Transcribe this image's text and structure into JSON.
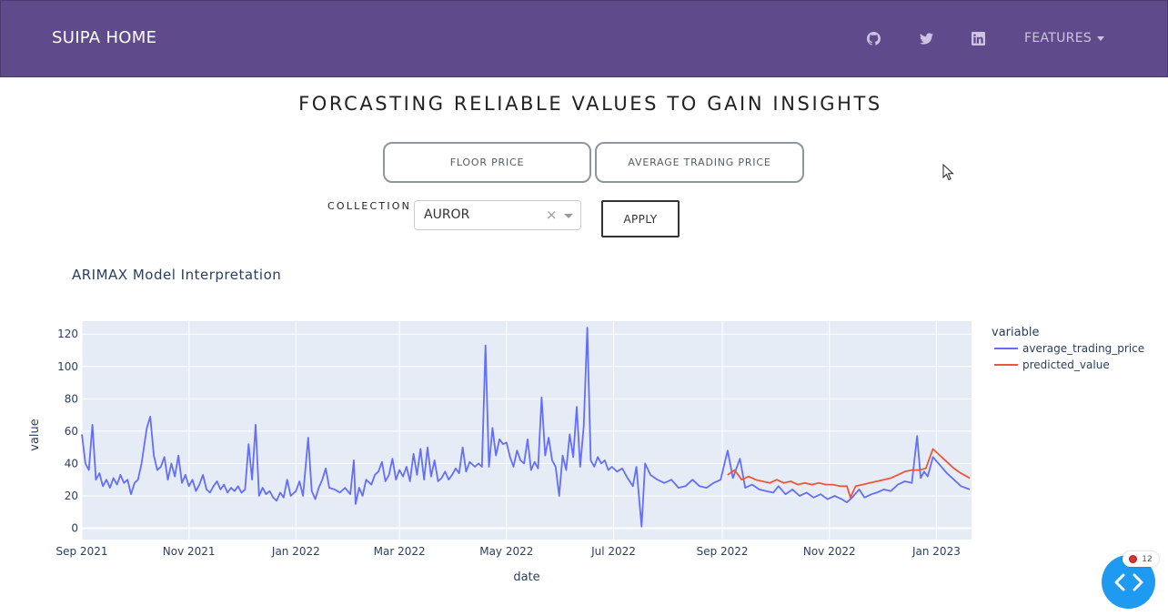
{
  "navbar": {
    "brand": "SUIPA HOME",
    "icons": [
      "github-icon",
      "twitter-icon",
      "linkedin-icon"
    ],
    "features_label": "FEATURES",
    "bg_color": "#5f4b8b"
  },
  "page": {
    "title": "FORCASTING RELIABLE VALUES TO GAIN INSIGHTS"
  },
  "tabs": [
    {
      "label": "FLOOR PRICE"
    },
    {
      "label": "AVERAGE TRADING PRICE"
    }
  ],
  "form": {
    "collection_label": "COLLECTION",
    "selected_collection": "AUROR",
    "clear_symbol": "×",
    "apply_label": "APPLY"
  },
  "debug_button": {
    "badge_count": "12",
    "color": "#1e9bf0"
  },
  "chart_data": {
    "type": "line",
    "title": "ARIMAX Model Interpretation",
    "xlabel": "date",
    "ylabel": "value",
    "legend_title": "variable",
    "legend_position": "right",
    "grid": true,
    "xlim": [
      "2021-09-01",
      "2023-01-21"
    ],
    "ylim": [
      -7,
      128
    ],
    "x_ticks": [
      {
        "date": "2021-09-01",
        "label": "Sep 2021"
      },
      {
        "date": "2021-11-01",
        "label": "Nov 2021"
      },
      {
        "date": "2022-01-01",
        "label": "Jan 2022"
      },
      {
        "date": "2022-03-01",
        "label": "Mar 2022"
      },
      {
        "date": "2022-05-01",
        "label": "May 2022"
      },
      {
        "date": "2022-07-01",
        "label": "Jul 2022"
      },
      {
        "date": "2022-09-01",
        "label": "Sep 2022"
      },
      {
        "date": "2022-11-01",
        "label": "Nov 2022"
      },
      {
        "date": "2023-01-01",
        "label": "Jan 2023"
      }
    ],
    "y_ticks": [
      0,
      20,
      40,
      60,
      80,
      100,
      120
    ],
    "series": [
      {
        "name": "average_trading_price",
        "color": "#636efa",
        "points": [
          [
            "2021-09-01",
            58
          ],
          [
            "2021-09-03",
            40
          ],
          [
            "2021-09-05",
            36
          ],
          [
            "2021-09-07",
            64
          ],
          [
            "2021-09-09",
            30
          ],
          [
            "2021-09-11",
            34
          ],
          [
            "2021-09-13",
            26
          ],
          [
            "2021-09-15",
            30
          ],
          [
            "2021-09-17",
            25
          ],
          [
            "2021-09-19",
            31
          ],
          [
            "2021-09-21",
            27
          ],
          [
            "2021-09-23",
            33
          ],
          [
            "2021-09-25",
            28
          ],
          [
            "2021-09-27",
            30
          ],
          [
            "2021-09-29",
            21
          ],
          [
            "2021-10-01",
            28
          ],
          [
            "2021-10-03",
            30
          ],
          [
            "2021-10-05",
            40
          ],
          [
            "2021-10-08",
            62
          ],
          [
            "2021-10-10",
            69
          ],
          [
            "2021-10-12",
            45
          ],
          [
            "2021-10-14",
            36
          ],
          [
            "2021-10-16",
            38
          ],
          [
            "2021-10-18",
            44
          ],
          [
            "2021-10-20",
            30
          ],
          [
            "2021-10-22",
            40
          ],
          [
            "2021-10-24",
            32
          ],
          [
            "2021-10-26",
            45
          ],
          [
            "2021-10-28",
            28
          ],
          [
            "2021-10-30",
            33
          ],
          [
            "2021-11-01",
            26
          ],
          [
            "2021-11-03",
            30
          ],
          [
            "2021-11-05",
            23
          ],
          [
            "2021-11-07",
            27
          ],
          [
            "2021-11-09",
            33
          ],
          [
            "2021-11-11",
            24
          ],
          [
            "2021-11-13",
            22
          ],
          [
            "2021-11-15",
            26
          ],
          [
            "2021-11-17",
            29
          ],
          [
            "2021-11-19",
            24
          ],
          [
            "2021-11-21",
            27
          ],
          [
            "2021-11-23",
            22
          ],
          [
            "2021-11-25",
            25
          ],
          [
            "2021-11-27",
            23
          ],
          [
            "2021-11-29",
            26
          ],
          [
            "2021-12-01",
            22
          ],
          [
            "2021-12-03",
            24
          ],
          [
            "2021-12-05",
            52
          ],
          [
            "2021-12-07",
            30
          ],
          [
            "2021-12-09",
            64
          ],
          [
            "2021-12-11",
            20
          ],
          [
            "2021-12-13",
            25
          ],
          [
            "2021-12-15",
            21
          ],
          [
            "2021-12-17",
            23
          ],
          [
            "2021-12-19",
            19
          ],
          [
            "2021-12-21",
            17
          ],
          [
            "2021-12-23",
            22
          ],
          [
            "2021-12-25",
            19
          ],
          [
            "2021-12-27",
            30
          ],
          [
            "2021-12-29",
            20
          ],
          [
            "2022-01-01",
            23
          ],
          [
            "2022-01-03",
            29
          ],
          [
            "2022-01-05",
            20
          ],
          [
            "2022-01-08",
            56
          ],
          [
            "2022-01-10",
            23
          ],
          [
            "2022-01-12",
            18
          ],
          [
            "2022-01-14",
            25
          ],
          [
            "2022-01-16",
            30
          ],
          [
            "2022-01-18",
            37
          ],
          [
            "2022-01-20",
            25
          ],
          [
            "2022-01-23",
            24
          ],
          [
            "2022-01-26",
            22
          ],
          [
            "2022-01-29",
            25
          ],
          [
            "2022-02-01",
            21
          ],
          [
            "2022-02-03",
            42
          ],
          [
            "2022-02-04",
            15
          ],
          [
            "2022-02-06",
            25
          ],
          [
            "2022-02-08",
            20
          ],
          [
            "2022-02-10",
            30
          ],
          [
            "2022-02-13",
            27
          ],
          [
            "2022-02-15",
            33
          ],
          [
            "2022-02-17",
            35
          ],
          [
            "2022-02-19",
            41
          ],
          [
            "2022-02-21",
            29
          ],
          [
            "2022-02-23",
            33
          ],
          [
            "2022-02-25",
            43
          ],
          [
            "2022-02-27",
            30
          ],
          [
            "2022-03-01",
            36
          ],
          [
            "2022-03-03",
            32
          ],
          [
            "2022-03-05",
            38
          ],
          [
            "2022-03-07",
            29
          ],
          [
            "2022-03-09",
            46
          ],
          [
            "2022-03-11",
            33
          ],
          [
            "2022-03-13",
            49
          ],
          [
            "2022-03-15",
            30
          ],
          [
            "2022-03-17",
            50
          ],
          [
            "2022-03-19",
            32
          ],
          [
            "2022-03-21",
            42
          ],
          [
            "2022-03-23",
            29
          ],
          [
            "2022-03-25",
            31
          ],
          [
            "2022-03-27",
            35
          ],
          [
            "2022-03-29",
            30
          ],
          [
            "2022-03-31",
            33
          ],
          [
            "2022-04-02",
            37
          ],
          [
            "2022-04-04",
            34
          ],
          [
            "2022-04-06",
            50
          ],
          [
            "2022-04-08",
            35
          ],
          [
            "2022-04-10",
            41
          ],
          [
            "2022-04-13",
            38
          ],
          [
            "2022-04-15",
            40
          ],
          [
            "2022-04-17",
            38
          ],
          [
            "2022-04-19",
            113
          ],
          [
            "2022-04-21",
            38
          ],
          [
            "2022-04-23",
            62
          ],
          [
            "2022-04-25",
            45
          ],
          [
            "2022-04-27",
            55
          ],
          [
            "2022-04-29",
            52
          ],
          [
            "2022-05-01",
            53
          ],
          [
            "2022-05-03",
            44
          ],
          [
            "2022-05-05",
            38
          ],
          [
            "2022-05-07",
            48
          ],
          [
            "2022-05-09",
            42
          ],
          [
            "2022-05-11",
            40
          ],
          [
            "2022-05-13",
            55
          ],
          [
            "2022-05-15",
            36
          ],
          [
            "2022-05-17",
            41
          ],
          [
            "2022-05-19",
            37
          ],
          [
            "2022-05-21",
            81
          ],
          [
            "2022-05-23",
            45
          ],
          [
            "2022-05-25",
            56
          ],
          [
            "2022-05-27",
            42
          ],
          [
            "2022-05-29",
            38
          ],
          [
            "2022-05-31",
            20
          ],
          [
            "2022-06-02",
            45
          ],
          [
            "2022-06-04",
            36
          ],
          [
            "2022-06-06",
            58
          ],
          [
            "2022-06-08",
            44
          ],
          [
            "2022-06-10",
            75
          ],
          [
            "2022-06-12",
            38
          ],
          [
            "2022-06-14",
            63
          ],
          [
            "2022-06-16",
            124
          ],
          [
            "2022-06-18",
            42
          ],
          [
            "2022-06-20",
            38
          ],
          [
            "2022-06-22",
            44
          ],
          [
            "2022-06-24",
            40
          ],
          [
            "2022-06-26",
            42
          ],
          [
            "2022-06-28",
            36
          ],
          [
            "2022-06-30",
            38
          ],
          [
            "2022-07-03",
            35
          ],
          [
            "2022-07-06",
            37
          ],
          [
            "2022-07-09",
            31
          ],
          [
            "2022-07-12",
            26
          ],
          [
            "2022-07-14",
            38
          ],
          [
            "2022-07-17",
            1
          ],
          [
            "2022-07-19",
            40
          ],
          [
            "2022-07-22",
            33
          ],
          [
            "2022-07-26",
            30
          ],
          [
            "2022-07-30",
            28
          ],
          [
            "2022-08-03",
            30
          ],
          [
            "2022-08-07",
            25
          ],
          [
            "2022-08-11",
            26
          ],
          [
            "2022-08-15",
            30
          ],
          [
            "2022-08-19",
            26
          ],
          [
            "2022-08-23",
            25
          ],
          [
            "2022-08-27",
            28
          ],
          [
            "2022-08-31",
            30
          ],
          [
            "2022-09-04",
            48
          ],
          [
            "2022-09-07",
            31
          ],
          [
            "2022-09-11",
            43
          ],
          [
            "2022-09-14",
            25
          ],
          [
            "2022-09-18",
            27
          ],
          [
            "2022-09-22",
            24
          ],
          [
            "2022-09-26",
            23
          ],
          [
            "2022-09-30",
            22
          ],
          [
            "2022-10-03",
            26
          ],
          [
            "2022-10-07",
            21
          ],
          [
            "2022-10-11",
            24
          ],
          [
            "2022-10-15",
            20
          ],
          [
            "2022-10-19",
            22
          ],
          [
            "2022-10-23",
            19
          ],
          [
            "2022-10-27",
            21
          ],
          [
            "2022-10-31",
            18
          ],
          [
            "2022-11-04",
            20
          ],
          [
            "2022-11-08",
            18
          ],
          [
            "2022-11-11",
            16
          ],
          [
            "2022-11-14",
            19
          ],
          [
            "2022-11-18",
            24
          ],
          [
            "2022-11-21",
            19
          ],
          [
            "2022-11-25",
            21
          ],
          [
            "2022-11-28",
            22
          ],
          [
            "2022-12-02",
            24
          ],
          [
            "2022-12-06",
            23
          ],
          [
            "2022-12-10",
            27
          ],
          [
            "2022-12-14",
            29
          ],
          [
            "2022-12-18",
            28
          ],
          [
            "2022-12-21",
            57
          ],
          [
            "2022-12-23",
            31
          ],
          [
            "2022-12-25",
            35
          ],
          [
            "2022-12-27",
            32
          ],
          [
            "2022-12-30",
            44
          ],
          [
            "2023-01-03",
            39
          ],
          [
            "2023-01-07",
            34
          ],
          [
            "2023-01-11",
            30
          ],
          [
            "2023-01-15",
            26
          ],
          [
            "2023-01-20",
            24
          ]
        ]
      },
      {
        "name": "predicted_value",
        "color": "#ef553b",
        "points": [
          [
            "2022-09-04",
            33
          ],
          [
            "2022-09-08",
            36
          ],
          [
            "2022-09-12",
            30
          ],
          [
            "2022-09-16",
            32
          ],
          [
            "2022-09-20",
            30
          ],
          [
            "2022-09-24",
            29
          ],
          [
            "2022-09-28",
            28
          ],
          [
            "2022-10-02",
            30
          ],
          [
            "2022-10-06",
            28
          ],
          [
            "2022-10-10",
            29
          ],
          [
            "2022-10-14",
            27
          ],
          [
            "2022-10-18",
            28
          ],
          [
            "2022-10-22",
            27
          ],
          [
            "2022-10-26",
            28
          ],
          [
            "2022-10-30",
            27
          ],
          [
            "2022-11-03",
            27
          ],
          [
            "2022-11-07",
            26
          ],
          [
            "2022-11-11",
            26
          ],
          [
            "2022-11-13",
            19
          ],
          [
            "2022-11-16",
            26
          ],
          [
            "2022-11-20",
            27
          ],
          [
            "2022-11-24",
            28
          ],
          [
            "2022-11-28",
            29
          ],
          [
            "2022-12-02",
            30
          ],
          [
            "2022-12-06",
            31
          ],
          [
            "2022-12-10",
            33
          ],
          [
            "2022-12-14",
            35
          ],
          [
            "2022-12-18",
            36
          ],
          [
            "2022-12-22",
            36
          ],
          [
            "2022-12-26",
            37
          ],
          [
            "2022-12-30",
            49
          ],
          [
            "2023-01-03",
            45
          ],
          [
            "2023-01-07",
            41
          ],
          [
            "2023-01-11",
            37
          ],
          [
            "2023-01-15",
            34
          ],
          [
            "2023-01-20",
            31
          ]
        ]
      }
    ]
  }
}
